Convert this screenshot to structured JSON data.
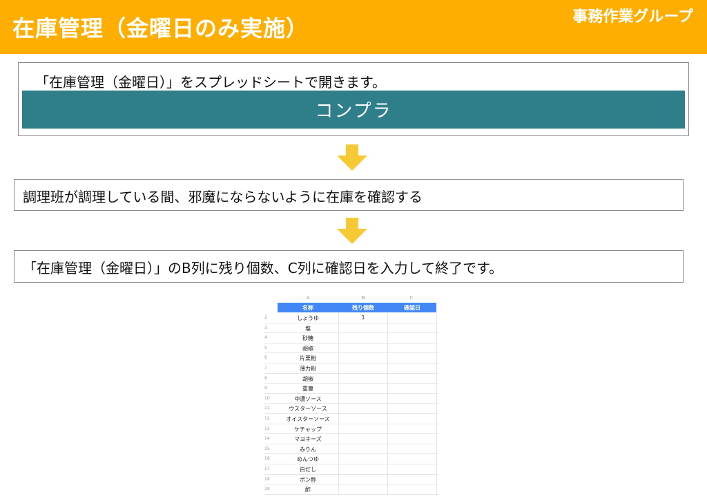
{
  "header": {
    "title": "在庫管理（金曜日のみ実施）",
    "group": "事務作業グループ",
    "color": "#fdae01"
  },
  "steps": [
    {
      "text": "「在庫管理（金曜日）」をスプレッドシートで開きます。",
      "banner": "コンプラ",
      "banner_color": "#2f7f8b"
    },
    {
      "text": "調理班が調理している間、邪魔にならないように在庫を確認する"
    },
    {
      "text": "「在庫管理（金曜日）」のB列に残り個数、C列に確認日を入力して終了です。"
    }
  ],
  "arrow": {
    "icon": "down-arrow-icon",
    "color": "#f6c935"
  },
  "spreadsheet": {
    "column_letters": [
      "A",
      "B",
      "C"
    ],
    "headers": [
      "名称",
      "残り個数",
      "確認日"
    ],
    "header_color": "#4287f5",
    "rows": [
      {
        "num": "2",
        "name": "しょうゆ",
        "count": "1"
      },
      {
        "num": "3",
        "name": "塩",
        "count": ""
      },
      {
        "num": "4",
        "name": "砂糖",
        "count": ""
      },
      {
        "num": "5",
        "name": "胡椒",
        "count": ""
      },
      {
        "num": "6",
        "name": "片栗粉",
        "count": ""
      },
      {
        "num": "7",
        "name": "薄力粉",
        "count": ""
      },
      {
        "num": "8",
        "name": "胡椒",
        "count": ""
      },
      {
        "num": "9",
        "name": "重曹",
        "count": ""
      },
      {
        "num": "10",
        "name": "中濃ソース",
        "count": ""
      },
      {
        "num": "11",
        "name": "ウスターソース",
        "count": ""
      },
      {
        "num": "12",
        "name": "オイスターソース",
        "count": ""
      },
      {
        "num": "13",
        "name": "ケチャップ",
        "count": ""
      },
      {
        "num": "14",
        "name": "マヨネーズ",
        "count": ""
      },
      {
        "num": "15",
        "name": "みりん",
        "count": ""
      },
      {
        "num": "16",
        "name": "めんつゆ",
        "count": ""
      },
      {
        "num": "17",
        "name": "白だし",
        "count": ""
      },
      {
        "num": "18",
        "name": "ポン酢",
        "count": ""
      },
      {
        "num": "19",
        "name": "酢",
        "count": ""
      }
    ]
  }
}
